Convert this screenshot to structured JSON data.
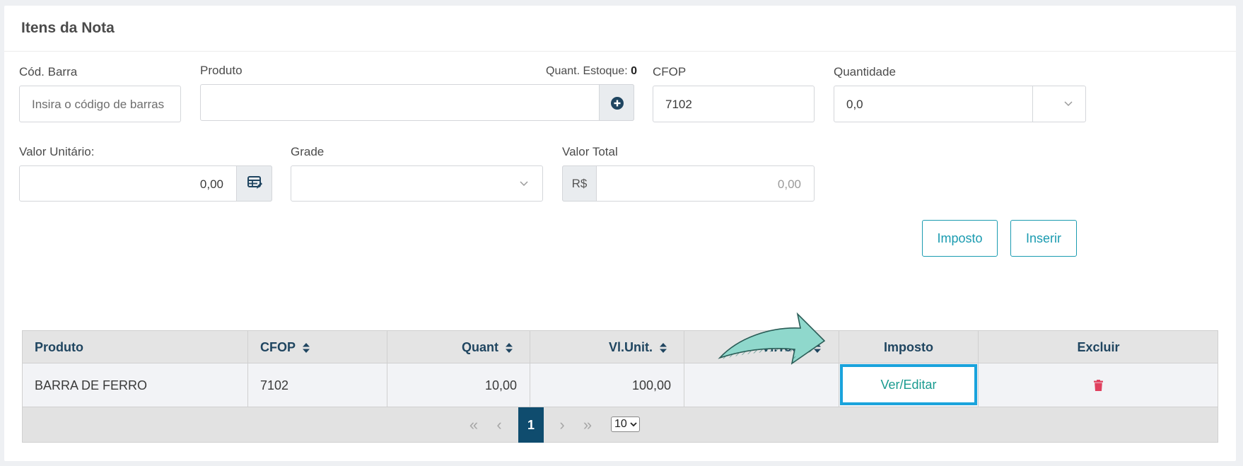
{
  "section": {
    "title": "Itens da Nota"
  },
  "form": {
    "barcode": {
      "label": "Cód. Barra",
      "placeholder": "Insira o código de barras"
    },
    "product": {
      "label": "Produto",
      "stock_label": "Quant. Estoque:",
      "stock_value": "0",
      "add_icon": "plus-circle-icon"
    },
    "cfop": {
      "label": "CFOP",
      "value": "7102"
    },
    "quantity": {
      "label": "Quantidade",
      "value": "0,0",
      "icon": "chevron-down-icon"
    },
    "unit_value": {
      "label": "Valor Unitário:",
      "value": "0,00",
      "icon": "table-edit-icon"
    },
    "grade": {
      "label": "Grade",
      "value": "",
      "icon": "chevron-down-icon"
    },
    "total_value": {
      "label": "Valor Total",
      "prefix": "R$",
      "placeholder": "0,00"
    }
  },
  "actions": {
    "tax_button": "Imposto",
    "insert_button": "Inserir"
  },
  "table": {
    "columns": [
      "Produto",
      "CFOP",
      "Quant",
      "Vl.Unit.",
      "Vl.Total",
      "Imposto",
      "Excluir"
    ],
    "rows": [
      {
        "produto": "BARRA DE FERRO",
        "cfop": "7102",
        "quant": "10,00",
        "vl_unit": "100,00",
        "vl_total": "",
        "imposto": "Ver/Editar",
        "excluir_icon": "trash-icon"
      }
    ]
  },
  "pagination": {
    "current_page": "1",
    "page_size": "10",
    "page_size_options": [
      "10"
    ]
  },
  "colors": {
    "accent": "#1a9bb0",
    "header_text": "#1f4560",
    "page_active": "#0f4c6e",
    "delete": "#e0405e",
    "highlight": "#1aa3dc",
    "arrow": "#8fd8cc"
  }
}
